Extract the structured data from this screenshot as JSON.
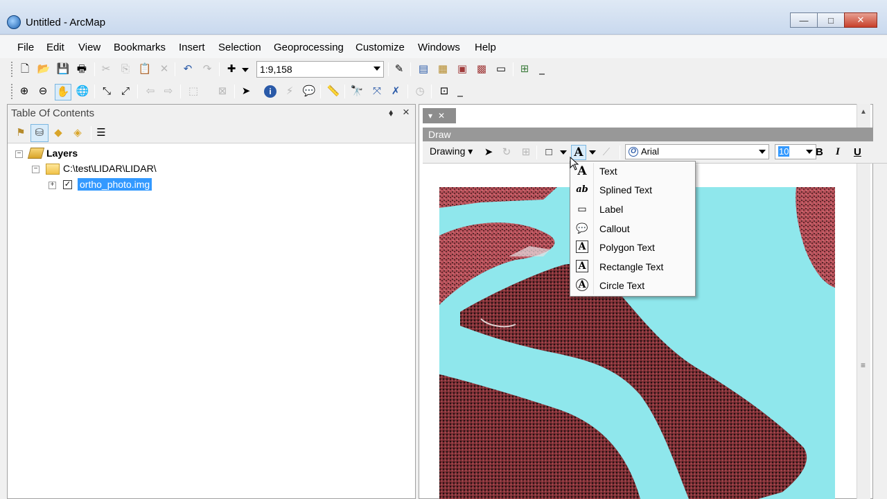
{
  "window": {
    "title": "Untitled - ArcMap",
    "minimize_glyph": "—",
    "maximize_glyph": "□",
    "close_glyph": "✕"
  },
  "menubar": [
    "File",
    "Edit",
    "View",
    "Bookmarks",
    "Insert",
    "Selection",
    "Geoprocessing",
    "Customize",
    "Windows",
    "Help"
  ],
  "standard_toolbar": {
    "scale": "1:9,158"
  },
  "toc": {
    "title": "Table Of Contents",
    "pin_glyph": "⬧",
    "close_glyph": "×",
    "root": "Layers",
    "folder": "C:\\test\\LIDAR\\LIDAR\\",
    "layer": "ortho_photo.img"
  },
  "draw_toolbar": {
    "title": "Draw",
    "drawing_label": "Drawing",
    "font": "Arial",
    "font_size": "10",
    "bold": "B",
    "italic": "I",
    "underline": "U"
  },
  "text_menu": {
    "items": [
      {
        "label": "Text",
        "icon": "text-icon"
      },
      {
        "label": "Splined Text",
        "icon": "splined-text-icon"
      },
      {
        "label": "Label",
        "icon": "label-icon"
      },
      {
        "label": "Callout",
        "icon": "callout-icon"
      },
      {
        "label": "Polygon Text",
        "icon": "polygon-text-icon"
      },
      {
        "label": "Rectangle Text",
        "icon": "rectangle-text-icon"
      },
      {
        "label": "Circle Text",
        "icon": "circle-text-icon"
      }
    ]
  },
  "colors": {
    "selection": "#3399ff",
    "water": "#8fe7ec",
    "vegetation": "#b8515a"
  }
}
